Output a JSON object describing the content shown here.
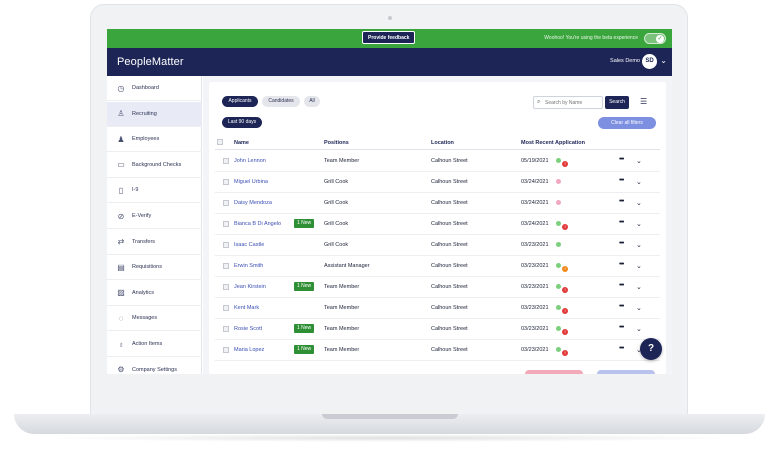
{
  "beta": {
    "feedback_label": "Provide feedback",
    "message": "Woohoo! You're using the beta experience",
    "toggle_on": true
  },
  "header": {
    "brand": "PeopleMatter",
    "user_name": "Sales Demo",
    "avatar_initials": "SD"
  },
  "sidebar": {
    "items": [
      {
        "label": "Dashboard",
        "icon": "clock-icon",
        "active": false
      },
      {
        "label": "Recruiting",
        "icon": "person-plus-icon",
        "active": true
      },
      {
        "label": "Employees",
        "icon": "people-icon",
        "active": false
      },
      {
        "label": "Background Checks",
        "icon": "id-card-icon",
        "active": false
      },
      {
        "label": "I-9",
        "icon": "document-icon",
        "active": false
      },
      {
        "label": "E-Verify",
        "icon": "check-circle-icon",
        "active": false
      },
      {
        "label": "Transfers",
        "icon": "transfer-icon",
        "active": false
      },
      {
        "label": "Requisitions",
        "icon": "clipboard-icon",
        "active": false
      },
      {
        "label": "Analytics",
        "icon": "chart-icon",
        "active": false
      },
      {
        "label": "Messages",
        "icon": "chat-icon",
        "active": false
      },
      {
        "label": "Action Items",
        "icon": "bell-icon",
        "active": false
      },
      {
        "label": "Company Settings",
        "icon": "gear-icon",
        "active": false
      }
    ]
  },
  "filters": {
    "tabs": [
      "Applicants",
      "Candidates",
      "All"
    ],
    "date_range": "Last 90 days",
    "search_placeholder": "Search by Name",
    "search_button": "Search",
    "clear_label": "Clear all filters"
  },
  "table": {
    "columns": [
      "Name",
      "Positions",
      "Location",
      "Most Recent Application"
    ],
    "new_label": "1 New",
    "rows": [
      {
        "name": "John Lennon",
        "position": "Team Member",
        "location": "Calhoun Street",
        "date": "05/19/2021",
        "dot": "green",
        "alert": "red",
        "is_new": false
      },
      {
        "name": "Miguel Urbina",
        "position": "Grill Cook",
        "location": "Calhoun Street",
        "date": "03/24/2021",
        "dot": "pink",
        "alert": "",
        "is_new": false
      },
      {
        "name": "Daisy Mendoza",
        "position": "Grill Cook",
        "location": "Calhoun Street",
        "date": "03/24/2021",
        "dot": "pink",
        "alert": "",
        "is_new": false
      },
      {
        "name": "Bianca B Di Angelo",
        "position": "Grill Cook",
        "location": "Calhoun Street",
        "date": "03/24/2021",
        "dot": "green",
        "alert": "red",
        "is_new": true
      },
      {
        "name": "Isaac Castle",
        "position": "Grill Cook",
        "location": "Calhoun Street",
        "date": "03/23/2021",
        "dot": "green",
        "alert": "",
        "is_new": false
      },
      {
        "name": "Erwin Smith",
        "position": "Assistant Manager",
        "location": "Calhoun Street",
        "date": "03/23/2021",
        "dot": "green",
        "alert": "orange",
        "is_new": false
      },
      {
        "name": "Jean Kirstein",
        "position": "Team Member",
        "location": "Calhoun Street",
        "date": "03/23/2021",
        "dot": "green",
        "alert": "red",
        "is_new": true
      },
      {
        "name": "Kent Mark",
        "position": "Team Member",
        "location": "Calhoun Street",
        "date": "03/23/2021",
        "dot": "green",
        "alert": "red",
        "is_new": false
      },
      {
        "name": "Rosie Scott",
        "position": "Team Member",
        "location": "Calhoun Street",
        "date": "03/23/2021",
        "dot": "green",
        "alert": "red",
        "is_new": true
      },
      {
        "name": "Maria Lopez",
        "position": "Team Member",
        "location": "Calhoun Street",
        "date": "03/23/2021",
        "dot": "green",
        "alert": "red",
        "is_new": true
      }
    ]
  },
  "help": {
    "label": "?"
  },
  "colors": {
    "navy": "#1c2556",
    "beta_green": "#3aa53c",
    "new_badge": "#2f8f35",
    "link": "#3b4fb4",
    "clear_button": "#7c8fe0"
  }
}
